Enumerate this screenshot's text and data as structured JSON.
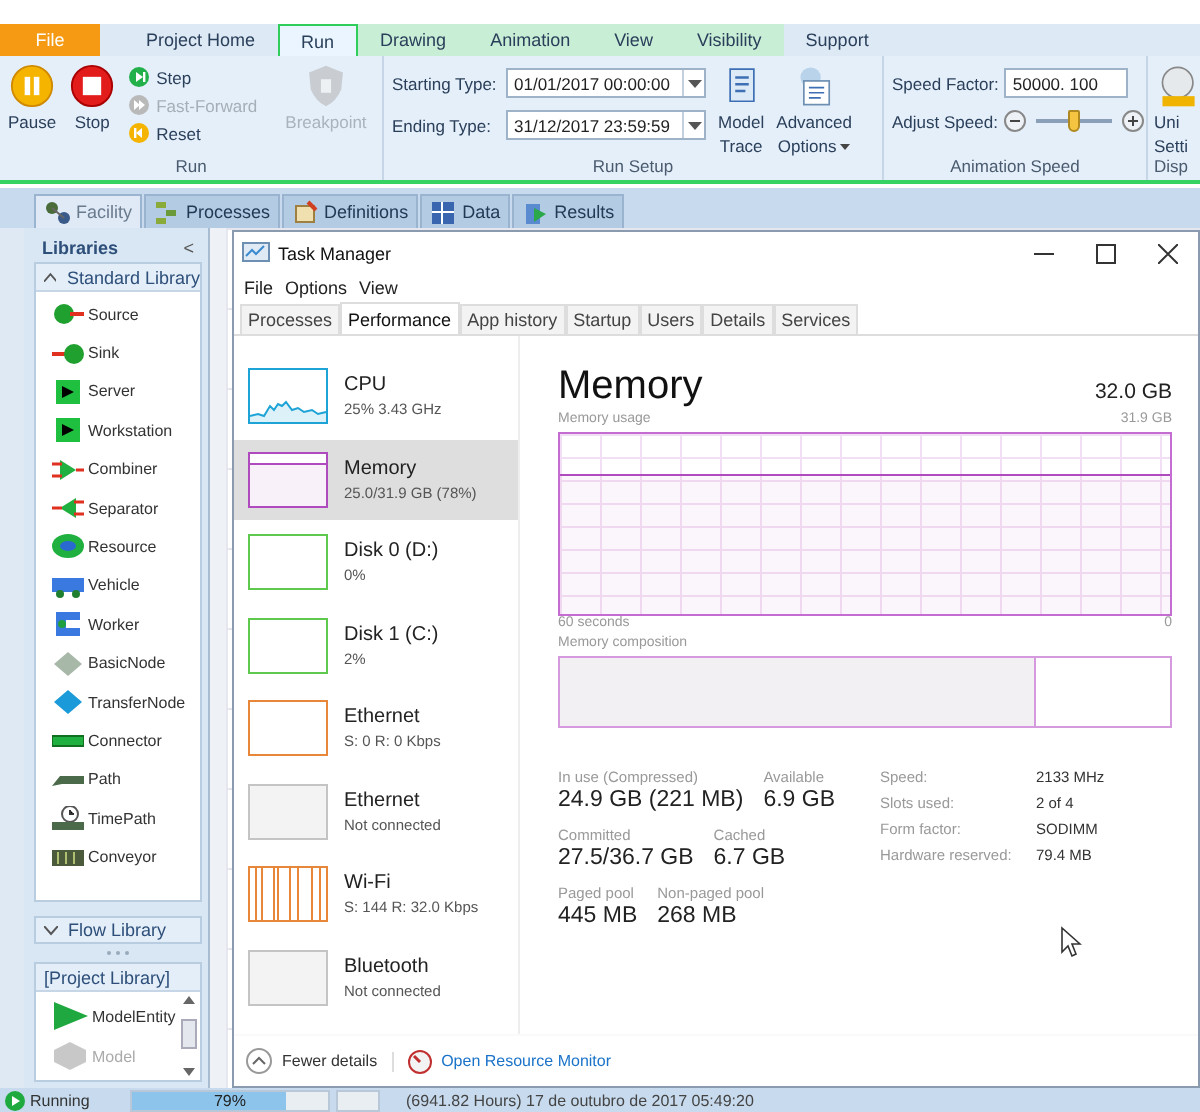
{
  "ribbon": {
    "tabs": [
      {
        "label": "File",
        "kind": "file",
        "selected": false
      },
      {
        "label": "Project Home",
        "kind": "plain",
        "selected": false
      },
      {
        "label": "Run",
        "kind": "plain",
        "selected": true
      },
      {
        "label": "Drawing",
        "kind": "context",
        "selected": false
      },
      {
        "label": "Animation",
        "kind": "context",
        "selected": false
      },
      {
        "label": "View",
        "kind": "context",
        "selected": false
      },
      {
        "label": "Visibility",
        "kind": "context",
        "selected": false
      },
      {
        "label": "Support",
        "kind": "plain",
        "selected": false
      }
    ],
    "run_group": {
      "label": "Run",
      "big_buttons": [
        {
          "label": "Pause",
          "kind": "pause"
        },
        {
          "label": "Stop",
          "kind": "stop"
        }
      ],
      "small_buttons": [
        {
          "label": "Step",
          "kind": "step",
          "disabled": false
        },
        {
          "label": "Fast-Forward",
          "kind": "forward",
          "disabled": true
        },
        {
          "label": "Reset",
          "kind": "reset",
          "disabled": false
        }
      ],
      "breakpoint": {
        "label": "Breakpoint",
        "disabled": true
      }
    },
    "run_setup": {
      "label": "Run Setup",
      "fields": [
        {
          "label": "Starting Type:",
          "value": "01/01/2017 00:00:00"
        },
        {
          "label": "Ending Type:",
          "value": "31/12/2017 23:59:59"
        }
      ],
      "model_trace": [
        "Model",
        "Trace"
      ],
      "advanced_options": [
        "Advanced",
        "Options"
      ]
    },
    "animation_speed": {
      "label": "Animation Speed",
      "speed_factor": {
        "label": "Speed Factor:",
        "value": "50000. 100"
      },
      "adjust_speed": {
        "label": "Adjust Speed:",
        "level": 0.5
      }
    },
    "cut_group": {
      "button": [
        "Uni",
        "Setti"
      ],
      "label": "Disp"
    }
  },
  "doc_tabs": [
    {
      "label": "Facility",
      "selected": true
    },
    {
      "label": "Processes",
      "selected": false
    },
    {
      "label": "Definitions",
      "selected": false
    },
    {
      "label": "Data",
      "selected": false
    },
    {
      "label": "Results",
      "selected": false
    }
  ],
  "libraries": {
    "title": "Libraries",
    "collapse": "<",
    "standard": {
      "title": "Standard Library",
      "expanded": true,
      "items": [
        "Source",
        "Sink",
        "Server",
        "Workstation",
        "Combiner",
        "Separator",
        "Resource",
        "Vehicle",
        "Worker",
        "BasicNode",
        "TransferNode",
        "Connector",
        "Path",
        "TimePath",
        "Conveyor"
      ]
    },
    "flow": {
      "title": "Flow Library",
      "expanded": false
    },
    "project": {
      "title": "[Project Library]",
      "items": [
        {
          "label": "ModelEntity",
          "disabled": false
        },
        {
          "label": "Model",
          "disabled": true
        }
      ]
    }
  },
  "task_manager": {
    "title": "Task Manager",
    "menu": [
      "File",
      "Options",
      "View"
    ],
    "tabs": [
      {
        "label": "Processes",
        "selected": false
      },
      {
        "label": "Performance",
        "selected": true
      },
      {
        "label": "App history",
        "selected": false
      },
      {
        "label": "Startup",
        "selected": false
      },
      {
        "label": "Users",
        "selected": false
      },
      {
        "label": "Details",
        "selected": false
      },
      {
        "label": "Services",
        "selected": false
      }
    ],
    "resources": [
      {
        "name": "CPU",
        "detail": "25%  3.43 GHz",
        "kind": "line",
        "color": "#1ea3d6",
        "selected": false
      },
      {
        "name": "Memory",
        "detail": "25.0/31.9 GB (78%)",
        "kind": "fill",
        "color": "#b04bbf",
        "selected": true
      },
      {
        "name": "Disk 0 (D:)",
        "detail": "0%",
        "kind": "flat",
        "color": "#5ec94c",
        "selected": false
      },
      {
        "name": "Disk 1 (C:)",
        "detail": "2%",
        "kind": "flat",
        "color": "#5ec94c",
        "selected": false
      },
      {
        "name": "Ethernet",
        "detail": "S: 0 R: 0 Kbps",
        "kind": "flat",
        "color": "#e8873a",
        "selected": false
      },
      {
        "name": "Ethernet",
        "detail": "Not connected",
        "kind": "flat",
        "color": "#c4c4c4",
        "selected": false
      },
      {
        "name": "Wi-Fi",
        "detail": "S: 144 R: 32.0 Kbps",
        "kind": "spikes",
        "color": "#e8873a",
        "selected": false
      },
      {
        "name": "Bluetooth",
        "detail": "Not connected",
        "kind": "flat",
        "color": "#c4c4c4",
        "selected": false
      }
    ],
    "detail": {
      "heading": "Memory",
      "total": "32.0 GB",
      "usage_label": "Memory usage",
      "usage_max": "31.9 GB",
      "time_span": "60 seconds",
      "usage_min": "0",
      "composition_label": "Memory composition",
      "composition": {
        "level": 0.78
      },
      "stats": [
        [
          {
            "label": "In use (Compressed)",
            "value": "24.9 GB (221 MB)"
          },
          {
            "label": "Available",
            "value": "6.9 GB"
          }
        ],
        [
          {
            "label": "Committed",
            "value": "27.5/36.7 GB"
          },
          {
            "label": "Cached",
            "value": "6.7 GB"
          }
        ],
        [
          {
            "label": "Paged pool",
            "value": "445 MB"
          },
          {
            "label": "Non-paged pool",
            "value": "268 MB"
          }
        ]
      ],
      "specs": [
        {
          "label": "Speed:",
          "value": "2133 MHz"
        },
        {
          "label": "Slots used:",
          "value": "2 of 4"
        },
        {
          "label": "Form factor:",
          "value": "SODIMM"
        },
        {
          "label": "Hardware reserved:",
          "value": "79.4 MB"
        }
      ]
    },
    "footer": {
      "fewer": "Fewer details",
      "monitor": "Open Resource Monitor"
    }
  },
  "status_bar": {
    "state": "Running",
    "progress": {
      "level": 0.79,
      "text": "79%"
    },
    "time": "(6941.82 Hours) 17 de outubro de 2017 05:49:20"
  }
}
